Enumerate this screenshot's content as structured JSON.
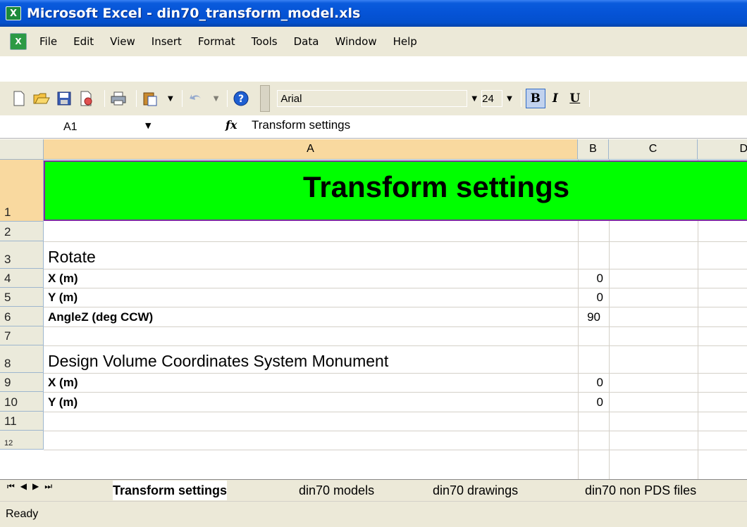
{
  "window": {
    "title": "Microsoft Excel - din70_transform_model.xls"
  },
  "menu": [
    "File",
    "Edit",
    "View",
    "Insert",
    "Format",
    "Tools",
    "Data",
    "Window",
    "Help"
  ],
  "toolbar": {
    "icons": [
      "new-icon",
      "open-icon",
      "save-icon",
      "print-preview-icon",
      "print-icon",
      "paste-icon",
      "undo-icon",
      "help-icon"
    ],
    "font_name": "Arial",
    "font_size": "24",
    "bold": "B",
    "italic": "I",
    "underline": "U"
  },
  "formula_bar": {
    "name_box": "A1",
    "fx": "fx",
    "content": "Transform settings"
  },
  "columns": [
    "A",
    "B",
    "C",
    "D"
  ],
  "rows": [
    "1",
    "2",
    "3",
    "4",
    "5",
    "6",
    "7",
    "8",
    "9",
    "10",
    "11",
    "12"
  ],
  "cells": {
    "a1": "Transform settings",
    "a3": "Rotate",
    "a4": "X (m)",
    "b4": "0",
    "a5": "Y (m)",
    "b5": "0",
    "a6": "AngleZ (deg CCW)",
    "b6": "90",
    "a8": "Design Volume Coordinates System Monument",
    "a9": "X (m)",
    "b9": "0",
    "a10": "Y (m)",
    "b10": "0"
  },
  "sheet_tabs": [
    "Transform settings",
    "din70 models",
    "din70 drawings",
    "din70 non PDS files"
  ],
  "status": "Ready",
  "colors": {
    "title_bar": "#0553d6",
    "header_fill": "#00ff00",
    "header_border": "#7b2f9e",
    "chrome": "#ece9d8"
  }
}
